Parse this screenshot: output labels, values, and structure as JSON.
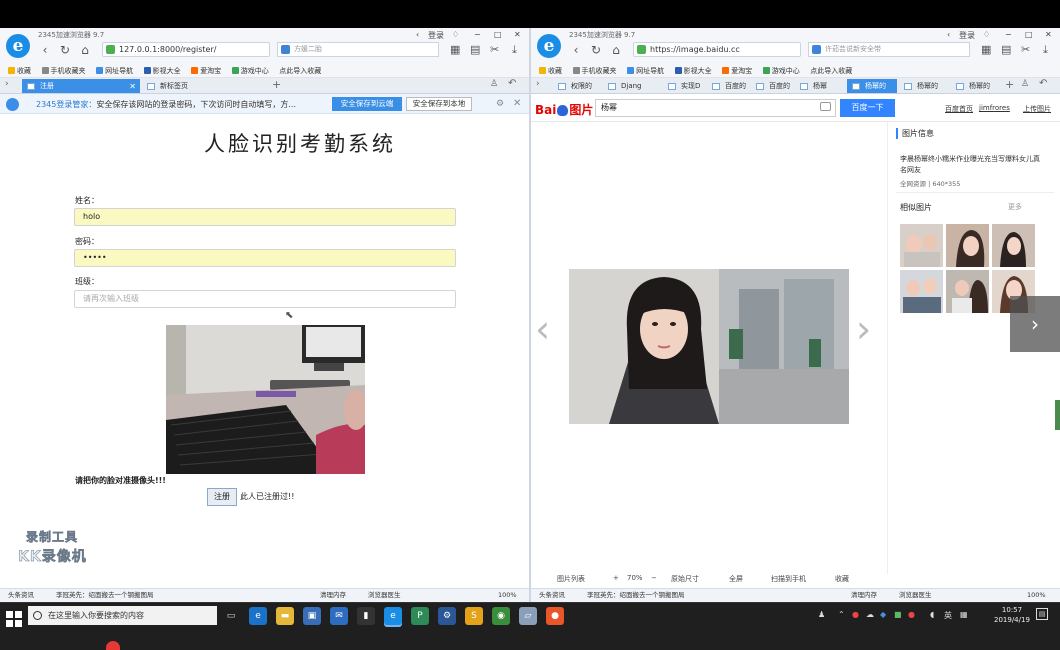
{
  "left_browser": {
    "app_name": "2345加速浏览器 9.7",
    "login_label": "登录",
    "address": "127.0.0.1:8000/register/",
    "search_placeholder": "方媛二胎",
    "bookmarks": [
      "收藏",
      "手机收藏夹",
      "网址导航",
      "影视大全",
      "爱淘宝",
      "游戏中心",
      "点此导入收藏"
    ],
    "tabs": [
      {
        "label": "注册",
        "active": true
      },
      {
        "label": "新标签页",
        "active": false
      }
    ],
    "password_bar": {
      "brand": "2345登录管家：",
      "message": "安全保存该网站的登录密码，下次访问时自动填写，方...",
      "primary_button": "安全保存到云端",
      "secondary_button": "安全保存到本地"
    },
    "page": {
      "title": "人脸识别考勤系统",
      "name_label": "姓名：",
      "name_value": "holo",
      "password_label": "密码：",
      "password_value": "•••••",
      "class_label": "班级：",
      "class_placeholder": "请再次输入班级",
      "camera_note": "请把你的脸对准摄像头!!!",
      "register_button": "注册",
      "register_message": "此人已注册过!!"
    },
    "watermark": {
      "line1": "录制工具",
      "line2": "KK录像机"
    },
    "status": {
      "left": "头条资讯",
      "news": "李冠英先：绍面搬去一个钢搬图局",
      "mid1": "清理内存",
      "mid2": "浏览器医生",
      "zoom": "100%"
    }
  },
  "right_browser": {
    "app_name": "2345加速浏览器 9.7",
    "login_label": "登录",
    "address": "https://image.baidu.cc",
    "search_placeholder": "许茹芸说新安全带",
    "bookmarks": [
      "收藏",
      "手机收藏夹",
      "网址导航",
      "影视大全",
      "爱淘宝",
      "游戏中心",
      "点此导入收藏"
    ],
    "tabs": [
      {
        "label": "权限的",
        "active": false
      },
      {
        "label": "Djang",
        "active": false
      },
      {
        "label": "实现D",
        "active": false
      },
      {
        "label": "百度的",
        "active": false
      },
      {
        "label": "百度的",
        "active": false
      },
      {
        "label": "杨幂",
        "active": false
      },
      {
        "label": "杨幂的",
        "active": true
      },
      {
        "label": "杨幂的",
        "active": false
      },
      {
        "label": "杨幂的",
        "active": false
      }
    ],
    "baidu": {
      "logo_text_left": "Bai",
      "logo_text_right": "图片",
      "query": "杨幂",
      "search_button": "百度一下",
      "links": [
        "百度首页",
        "jimfrores",
        "上传图片"
      ]
    },
    "info_panel": {
      "title": "图片信息",
      "description": "李晨杨幂终小糯米作业曝光充当写爆料女儿真名网友",
      "meta_source": "全网资源",
      "meta_size": "640*355",
      "similar_title": "相似图片",
      "more_label": "更多"
    },
    "viewer_toolbar": [
      "图片列表",
      "+",
      "70%",
      "−",
      "原始尺寸",
      "全屏",
      "扫描到手机",
      "收藏"
    ],
    "status": {
      "left": "头条资讯",
      "news": "李冠英先：绍面搬去一个钢搬图局",
      "mid1": "清理内存",
      "mid2": "浏览器医生",
      "zoom": "100%"
    }
  },
  "taskbar": {
    "search_placeholder": "在这里输入你要搜索的内容",
    "time": "10:57",
    "date": "2019/4/19",
    "ime": "英"
  }
}
